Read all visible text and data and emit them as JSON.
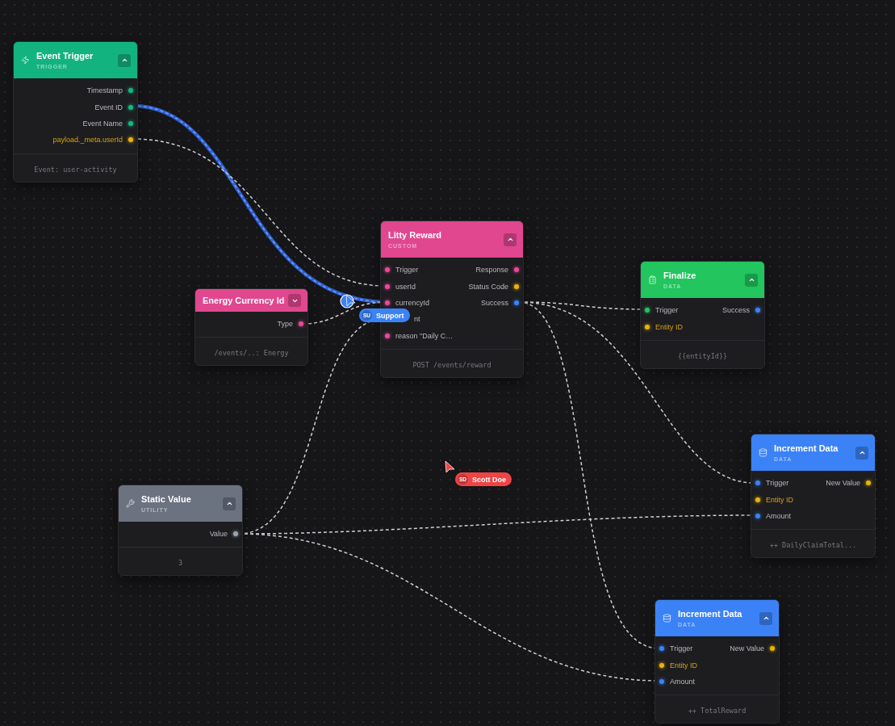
{
  "nodes": [
    {
      "title": "Event Trigger",
      "subtitle": "TRIGGER",
      "kind": "trigger",
      "color": "#13b37f",
      "expanded": true,
      "rows": [
        {
          "right": {
            "label": "Timestamp",
            "color": "#10b981",
            "accent": false
          }
        },
        {
          "right": {
            "label": "Event ID",
            "color": "#10b981",
            "accent": false
          }
        },
        {
          "right": {
            "label": "Event Name",
            "color": "#10b981",
            "accent": false
          }
        },
        {
          "right": {
            "label": "payload._meta.userId",
            "color": "#eab308",
            "accent": true
          }
        }
      ],
      "footer": "Event: user-activity"
    },
    {
      "title": "Energy Currency Id",
      "kind": "value",
      "color": "#e0478f",
      "expanded": false,
      "rows": [
        {
          "right": {
            "label": "Type",
            "color": "#ec4899",
            "accent": false
          }
        }
      ],
      "footer": "/events/..: Energy"
    },
    {
      "title": "Litty Reward",
      "subtitle": "CUSTOM",
      "kind": "custom",
      "color": "#e0478f",
      "expanded": true,
      "rows": [
        {
          "left": {
            "label": "Trigger",
            "color": "#ec4899",
            "accent": false
          },
          "right": {
            "label": "Response",
            "color": "#ec4899",
            "accent": false
          }
        },
        {
          "left": {
            "label": "userId",
            "color": "#ec4899",
            "accent": false
          },
          "right": {
            "label": "Status Code",
            "color": "#eab308",
            "accent": false
          }
        },
        {
          "left": {
            "label": "currencyId",
            "color": "#ec4899",
            "accent": false
          },
          "right": {
            "label": "Success",
            "color": "#3b82f6",
            "accent": false
          }
        },
        {
          "left": {
            "label": "nt",
            "accent": false,
            "covered": true
          }
        },
        {
          "left": {
            "label": "reason \"Daily C…",
            "color": "#ec4899",
            "accent": false
          }
        }
      ],
      "footer": "POST /events/reward"
    },
    {
      "title": "Finalize",
      "subtitle": "DATA",
      "kind": "clipboard",
      "color": "#22c55e",
      "expanded": true,
      "rows": [
        {
          "left": {
            "label": "Trigger",
            "color": "#22c55e",
            "accent": false
          },
          "right": {
            "label": "Success",
            "color": "#3b82f6",
            "accent": false
          }
        },
        {
          "left": {
            "label": "Entity ID",
            "color": "#eab308",
            "accent": true
          }
        }
      ],
      "footer": "{{entityId}}"
    },
    {
      "title": "Increment Data",
      "subtitle": "DATA",
      "kind": "data",
      "color": "#3b82f6",
      "expanded": true,
      "rows": [
        {
          "left": {
            "label": "Trigger",
            "color": "#3b82f6",
            "accent": false
          },
          "right": {
            "label": "New Value",
            "color": "#eab308",
            "accent": false
          }
        },
        {
          "left": {
            "label": "Entity ID",
            "color": "#eab308",
            "accent": true
          }
        },
        {
          "left": {
            "label": "Amount",
            "color": "#3b82f6",
            "accent": false
          }
        }
      ],
      "footer": "++ DailyClaimTotal..."
    },
    {
      "title": "Static Value",
      "subtitle": "UTILITY",
      "kind": "utility",
      "color": "#6b7280",
      "expanded": true,
      "rows": [
        {
          "right": {
            "label": "Value",
            "color": "#9ca3af",
            "accent": false
          }
        }
      ],
      "footer": "3"
    },
    {
      "title": "Increment Data",
      "subtitle": "DATA",
      "kind": "data",
      "color": "#3b82f6",
      "expanded": true,
      "rows": [
        {
          "left": {
            "label": "Trigger",
            "color": "#3b82f6",
            "accent": false
          },
          "right": {
            "label": "New Value",
            "color": "#eab308",
            "accent": false
          }
        },
        {
          "left": {
            "label": "Entity ID",
            "color": "#eab308",
            "accent": true
          }
        },
        {
          "left": {
            "label": "Amount",
            "color": "#3b82f6",
            "accent": false
          }
        }
      ],
      "footer": "++ TotalReward"
    }
  ],
  "cursors": [
    {
      "name": "Support",
      "initials": "SU",
      "color": "#3b82f6"
    },
    {
      "name": "Scott Doe",
      "initials": "SD",
      "color": "#ef4444"
    }
  ]
}
